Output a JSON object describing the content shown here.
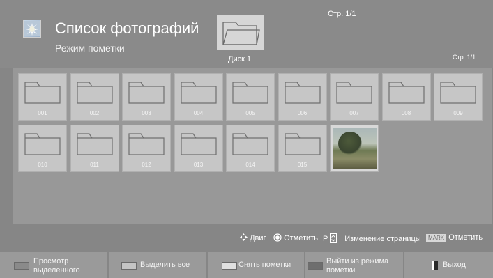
{
  "header": {
    "title": "Список фотографий",
    "subtitle": "Режим пометки",
    "top_page": "Стр. 1/1",
    "disk_label": "Диск 1",
    "right_page": "Стр. 1/1",
    "app_icon": "photo-album-icon",
    "disk_icon": "folder-icon"
  },
  "grid": {
    "row1": [
      "001",
      "002",
      "003",
      "004",
      "005",
      "006",
      "007",
      "008",
      "009"
    ],
    "row2": [
      "010",
      "011",
      "012",
      "013",
      "014",
      "015"
    ],
    "photo_icon": "photo-thumbnail"
  },
  "hints": {
    "move": "Двиг",
    "select": "Отметить",
    "page_key": "P",
    "page_change": "Изменение страницы",
    "mark_key": "MARK",
    "mark": "Отметить"
  },
  "buttons": {
    "view_line1": "Просмотр",
    "view_line2": "выделенного",
    "select_all": "Выделить все",
    "unmark": "Снять пометки",
    "exit_mode_line1": "Выйти из режима",
    "exit_mode_line2": "пометки",
    "exit": "Выход"
  },
  "colors": {
    "red_button": "#8a8a8a",
    "green_button": "#c4c4c4",
    "yellow_button": "#e0e0e0",
    "blue_button": "#6e6e6e"
  }
}
